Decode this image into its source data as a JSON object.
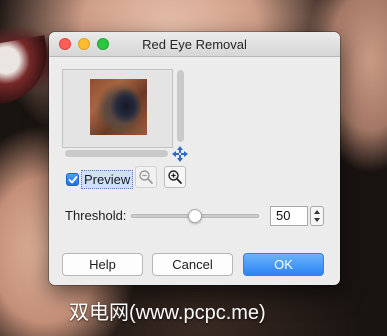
{
  "window": {
    "title": "Red Eye Removal"
  },
  "preview": {
    "checkbox_label": "Preview",
    "checked": true
  },
  "threshold": {
    "label": "Threshold:",
    "value": "50",
    "slider_fraction": 0.5
  },
  "buttons": {
    "help": "Help",
    "cancel": "Cancel",
    "ok": "OK"
  },
  "icons": {
    "move": "move-arrows-icon",
    "zoom_out": "zoom-out-icon",
    "zoom_in": "zoom-in-icon",
    "checkmark": "checkmark-icon"
  },
  "colors": {
    "accent": "#2a84f3",
    "close": "#fc5d57",
    "minimize": "#fdbc2e",
    "maximize": "#29c840"
  },
  "watermark": "双电网(www.pcpc.me)"
}
